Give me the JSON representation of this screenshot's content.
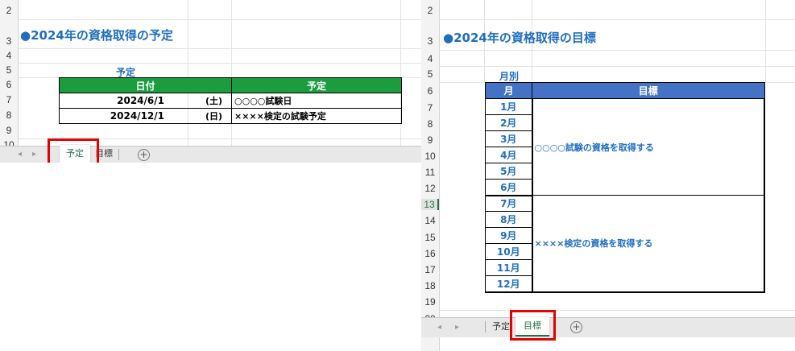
{
  "left_sheet": {
    "row_numbers": [
      "2",
      "3",
      "4",
      "5",
      "6",
      "7",
      "8",
      "9",
      "10"
    ],
    "title": "●2024年の資格取得の予定",
    "table_label": "予定",
    "headers": [
      "日付",
      "予定"
    ],
    "rows": [
      {
        "date": "2024/6/1",
        "day": "(土)",
        "plan": "○○○○試験日"
      },
      {
        "date": "2024/12/1",
        "day": "(日)",
        "plan": "××××検定の試験予定"
      }
    ],
    "tabs": [
      "予定",
      "目標"
    ],
    "active_tab": "予定",
    "header_color": "#1a9c3f"
  },
  "right_sheet": {
    "row_numbers": [
      "2",
      "3",
      "4",
      "5",
      "6",
      "7",
      "8",
      "9",
      "10",
      "11",
      "12",
      "13",
      "14",
      "15",
      "16",
      "17",
      "18",
      "19",
      "20"
    ],
    "title": "●2024年の資格取得の目標",
    "table_label": "月別",
    "headers": [
      "月",
      "目標"
    ],
    "months": [
      "1月",
      "2月",
      "3月",
      "4月",
      "5月",
      "6月",
      "7月",
      "8月",
      "9月",
      "10月",
      "11月",
      "12月"
    ],
    "goals": [
      "○○○○試験の資格を取得する",
      "××××検定の資格を取得する"
    ],
    "tabs": [
      "予定",
      "目標"
    ],
    "active_tab": "目標",
    "header_color": "#4472c4"
  },
  "icons": {
    "nav_prev": "◂",
    "nav_next": "▸",
    "add_sheet": "+"
  },
  "colors": {
    "title_blue": "#1f6ec0",
    "highlight_red": "#e60000",
    "tab_green": "#217346"
  }
}
